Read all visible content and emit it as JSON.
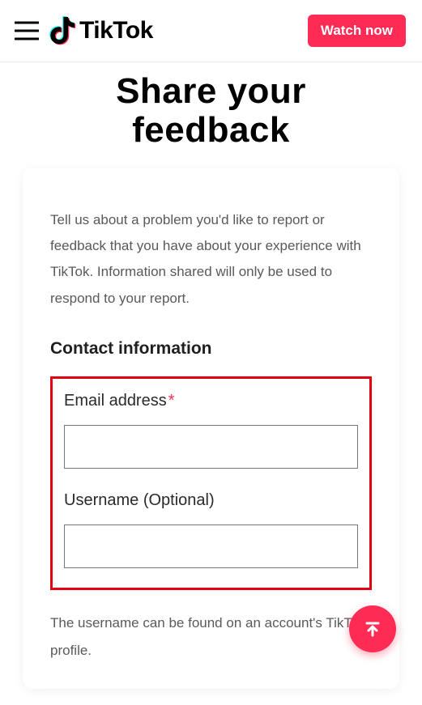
{
  "header": {
    "brand": "TikTok",
    "watch_button": "Watch now"
  },
  "page": {
    "title": "Share your feedback",
    "intro": "Tell us about a problem you'd like to report or feedback that you have about your experience with TikTok. Information shared will only be used to respond to your report.",
    "section_contact": "Contact information",
    "email_label": "Email address",
    "required_mark": "*",
    "username_label": "Username (Optional)",
    "username_note": "The username can be found on an account's TikTok profile.",
    "email_value": "",
    "username_value": ""
  },
  "colors": {
    "accent": "#fe2c55",
    "highlight_border": "#e60012"
  }
}
